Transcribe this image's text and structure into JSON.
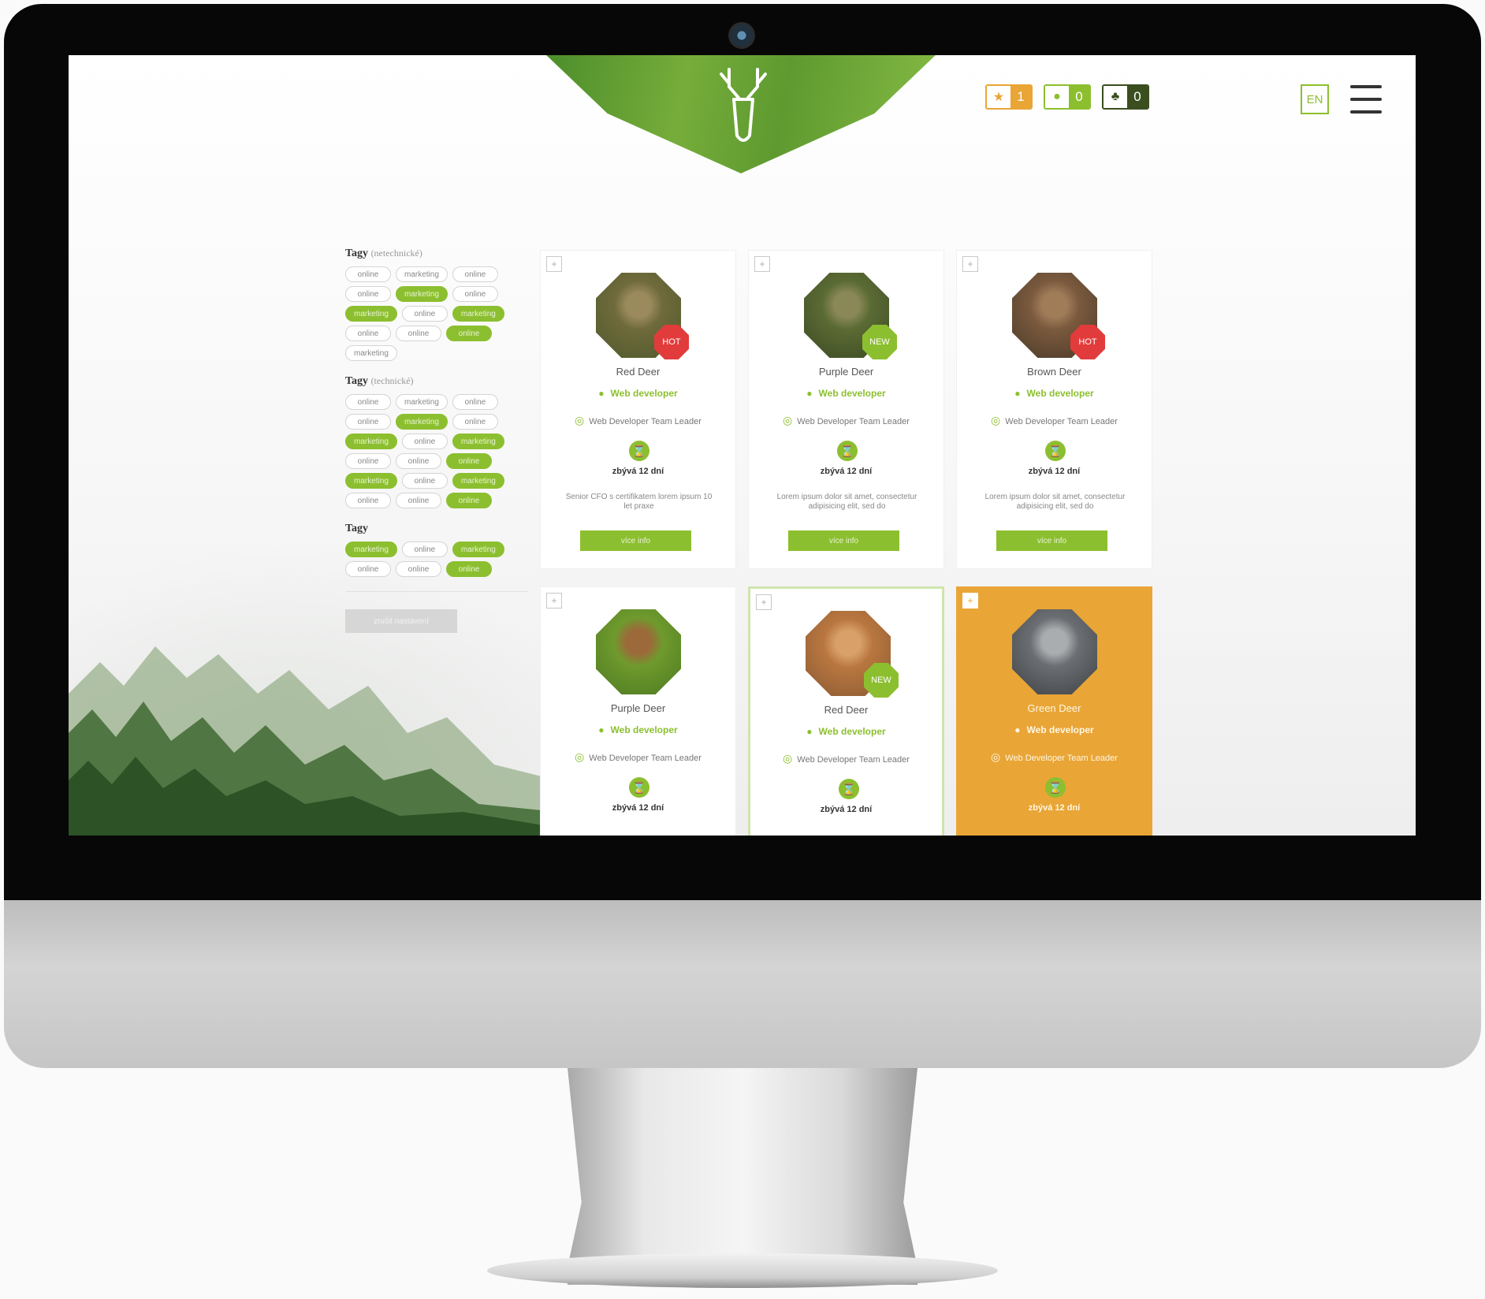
{
  "header": {
    "stats": [
      {
        "icon": "star-icon",
        "count": "1",
        "color": "#e9a536"
      },
      {
        "icon": "user-icon",
        "count": "0",
        "color": "#8cbf2f"
      },
      {
        "icon": "tree-icon",
        "count": "0",
        "color": "#3a4e1f"
      }
    ],
    "language": "EN"
  },
  "sidebar": {
    "groups": [
      {
        "title": "Tagy",
        "note": "(netechnické)",
        "tags": [
          {
            "label": "online",
            "active": false
          },
          {
            "label": "marketing",
            "active": false
          },
          {
            "label": "online",
            "active": false
          },
          {
            "label": "online",
            "active": false
          },
          {
            "label": "marketing",
            "active": true
          },
          {
            "label": "online",
            "active": false
          },
          {
            "label": "marketing",
            "active": true
          },
          {
            "label": "online",
            "active": false
          },
          {
            "label": "marketing",
            "active": true
          },
          {
            "label": "online",
            "active": false
          },
          {
            "label": "online",
            "active": false
          },
          {
            "label": "online",
            "active": true
          },
          {
            "label": "marketing",
            "active": false
          }
        ]
      },
      {
        "title": "Tagy",
        "note": "(technické)",
        "tags": [
          {
            "label": "online",
            "active": false
          },
          {
            "label": "marketing",
            "active": false
          },
          {
            "label": "online",
            "active": false
          },
          {
            "label": "online",
            "active": false
          },
          {
            "label": "marketing",
            "active": true
          },
          {
            "label": "online",
            "active": false
          },
          {
            "label": "marketing",
            "active": true
          },
          {
            "label": "online",
            "active": false
          },
          {
            "label": "marketing",
            "active": true
          },
          {
            "label": "online",
            "active": false
          },
          {
            "label": "online",
            "active": false
          },
          {
            "label": "online",
            "active": true
          },
          {
            "label": "marketing",
            "active": true
          },
          {
            "label": "online",
            "active": false
          },
          {
            "label": "marketing",
            "active": true
          },
          {
            "label": "online",
            "active": false
          },
          {
            "label": "online",
            "active": false
          },
          {
            "label": "online",
            "active": true
          }
        ]
      },
      {
        "title": "Tagy",
        "note": "",
        "tags": [
          {
            "label": "marketing",
            "active": true
          },
          {
            "label": "online",
            "active": false
          },
          {
            "label": "marketing",
            "active": true
          },
          {
            "label": "online",
            "active": false
          },
          {
            "label": "online",
            "active": false
          },
          {
            "label": "online",
            "active": true
          }
        ]
      }
    ],
    "reset_label": "zrušit nastavení"
  },
  "cards": [
    {
      "name": "Red Deer",
      "badge": "HOT",
      "badge_type": "hot",
      "role": "Web developer",
      "position": "Web Developer Team Leader",
      "remaining": "zbývá 12 dní",
      "description": "Senior CFO s certifikatem lorem ipsum 10 let praxe",
      "button": "více info",
      "style": "normal",
      "avatar_colors": [
        "#6f6a3b",
        "#9a8a5c",
        "#4f5a2d"
      ]
    },
    {
      "name": "Purple Deer",
      "badge": "NEW",
      "badge_type": "new",
      "role": "Web developer",
      "position": "Web Developer Team Leader",
      "remaining": "zbývá 12 dní",
      "description": "Lorem ipsum dolor sit amet, consectetur adipisicing elit, sed do",
      "button": "více info",
      "style": "normal",
      "avatar_colors": [
        "#5b6b34",
        "#8a8857",
        "#3c4a23"
      ]
    },
    {
      "name": "Brown Deer",
      "badge": "HOT",
      "badge_type": "hot",
      "role": "Web developer",
      "position": "Web Developer Team Leader",
      "remaining": "zbývá 12 dní",
      "description": "Lorem ipsum dolor sit amet, consectetur adipisicing elit, sed do",
      "button": "více info",
      "style": "normal",
      "avatar_colors": [
        "#7b5a3e",
        "#a07c59",
        "#4a3a28"
      ]
    },
    {
      "name": "Purple Deer",
      "badge": "",
      "badge_type": "",
      "role": "Web developer",
      "position": "Web Developer Team Leader",
      "remaining": "zbývá 12 dní",
      "description": "",
      "button": "",
      "style": "normal",
      "avatar_colors": [
        "#6f9a2d",
        "#9c6a3a",
        "#4d7a22"
      ]
    },
    {
      "name": "Red Deer",
      "badge": "NEW",
      "badge_type": "new",
      "role": "Web developer",
      "position": "Web Developer Team Leader",
      "remaining": "zbývá 12 dní",
      "description": "",
      "button": "",
      "style": "highlight",
      "avatar_colors": [
        "#b9773f",
        "#d9a06a",
        "#8a5a34"
      ]
    },
    {
      "name": "Green Deer",
      "badge": "",
      "badge_type": "",
      "role": "Web developer",
      "position": "Web Developer Team Leader",
      "remaining": "zbývá 12 dní",
      "description": "",
      "button": "",
      "style": "featured",
      "avatar_colors": [
        "#6b6f73",
        "#a9adaf",
        "#3e4245"
      ]
    }
  ]
}
